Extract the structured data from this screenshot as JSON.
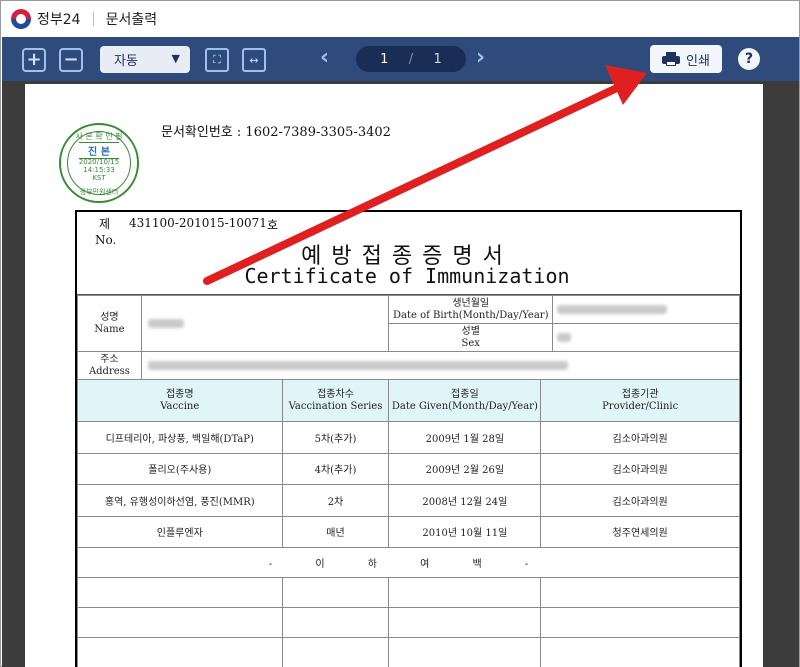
{
  "titlebar": {
    "app_name": "정부24",
    "page_title": "문서출력"
  },
  "toolbar": {
    "zoom_in_label": "+",
    "zoom_out_label": "−",
    "zoom_value": "자동",
    "fit_page_label": "⛶",
    "fit_width_label": "↔",
    "prev_label": "‹",
    "next_label": "›",
    "page_current": "1",
    "page_separator": "/",
    "page_total": "1",
    "print_label": "인쇄",
    "help_label": "?"
  },
  "stamp": {
    "top_text": "사 본 확 인 필",
    "main_text": "진 본",
    "date": "2020/10/15",
    "time": "14:15:33",
    "tz": "KST",
    "bottom_text": "정부민원센터"
  },
  "document": {
    "confirm_number_label": "문서확인번호",
    "confirm_number_value": ":  1602-7389-3305-3402"
  },
  "certificate": {
    "no_label_ko": "제",
    "no_label_en": "No.",
    "no_value": "431100-201015-10071",
    "no_suffix": "호",
    "title_ko": "예방접종증명서",
    "title_en": "Certificate of Immunization",
    "name_label_ko": "성명",
    "name_label_en": "Name",
    "dob_label_ko": "생년월일",
    "dob_label_en": "Date of Birth(Month/Day/Year)",
    "sex_label_ko": "성별",
    "sex_label_en": "Sex",
    "address_label_ko": "주소",
    "address_label_en": "Address",
    "headers": [
      {
        "ko": "접종명",
        "en": "Vaccine"
      },
      {
        "ko": "접종차수",
        "en": "Vaccination Series"
      },
      {
        "ko": "접종일",
        "en": "Date Given(Month/Day/Year)"
      },
      {
        "ko": "접종기관",
        "en": "Provider/Clinic"
      }
    ],
    "rows": [
      {
        "vaccine": "디프테리아, 파상풍, 백일해(DTaP)",
        "series": "5차(추가)",
        "date": "2009년  1월 28일",
        "clinic": "김소아과의원"
      },
      {
        "vaccine": "폴리오(주사용)",
        "series": "4차(추가)",
        "date": "2009년  2월 26일",
        "clinic": "김소아과의원"
      },
      {
        "vaccine": "홍역, 유행성이하선염, 풍진(MMR)",
        "series": "2차",
        "date": "2008년 12월 24일",
        "clinic": "김소아과의원"
      },
      {
        "vaccine": "인플루엔자",
        "series": "매년",
        "date": "2010년 10월 11일",
        "clinic": "청주연세의원"
      }
    ],
    "end_text": "- 이 하 여 백 -"
  },
  "colors": {
    "toolbar_bg": "#2e4b7c",
    "header_row_bg": "#dff5f7",
    "stamp_green": "#3a8a3a",
    "annotation_arrow": "#e02020"
  }
}
